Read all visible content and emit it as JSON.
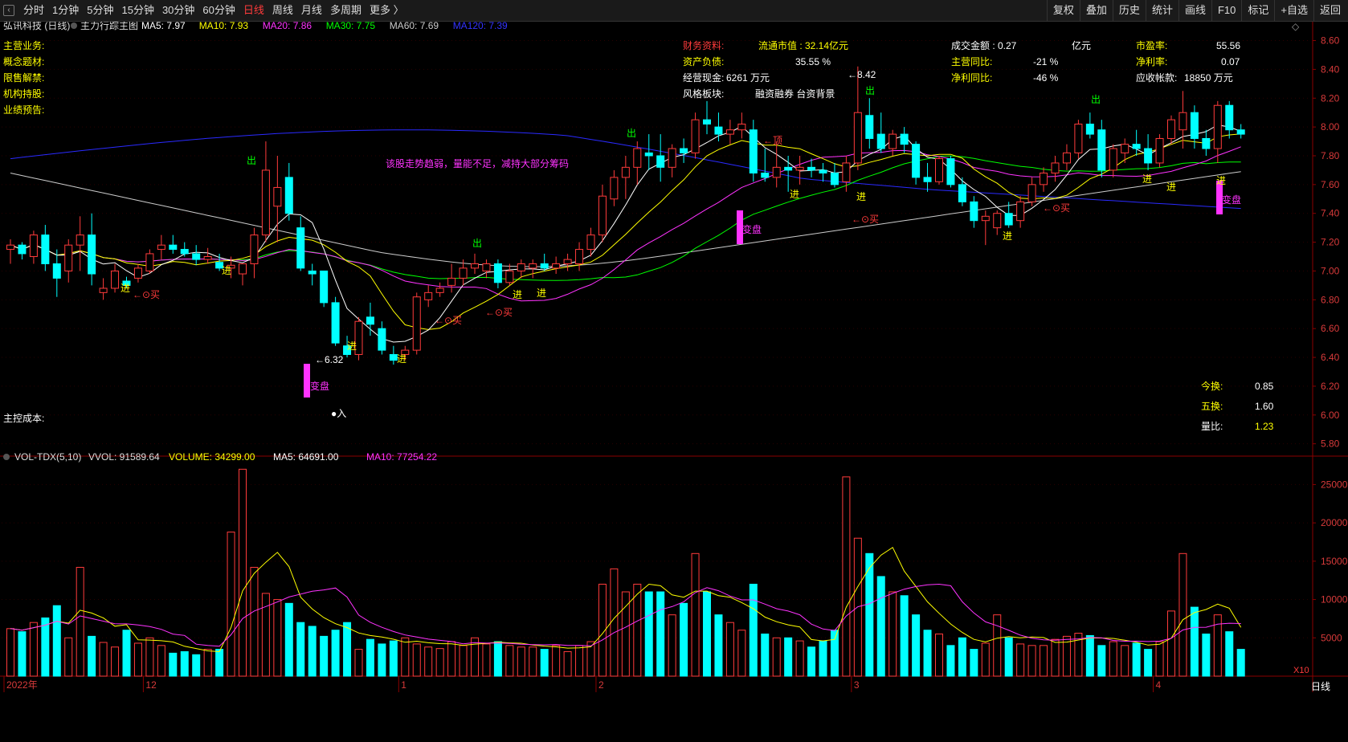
{
  "toolbar": {
    "left_items": [
      "分时",
      "1分钟",
      "5分钟",
      "15分钟",
      "30分钟",
      "60分钟",
      "日线",
      "周线",
      "月线",
      "多周期",
      "更多 〉"
    ],
    "active_index": 6,
    "right_items": [
      "复权",
      "叠加",
      "历史",
      "统计",
      "画线",
      "F10",
      "标记",
      "+自选",
      "返回"
    ]
  },
  "header": {
    "stock": "弘讯科技 (日线)",
    "indicator": "主力行踪主图",
    "mas": [
      {
        "label": "MA5: 7.97",
        "color": "#ffffff"
      },
      {
        "label": "MA10: 7.93",
        "color": "#ffff00"
      },
      {
        "label": "MA20: 7.86",
        "color": "#ff33ff"
      },
      {
        "label": "MA30: 7.75",
        "color": "#00ff00"
      },
      {
        "label": "MA60: 7.69",
        "color": "#cccccc"
      },
      {
        "label": "MA120: 7.39",
        "color": "#3333ff"
      }
    ]
  },
  "left_labels": [
    "主营业务:",
    "概念题材:",
    "限售解禁:",
    "机构持股:",
    "业绩预告:"
  ],
  "main_cost_label": "主控成本:",
  "finance": {
    "title": "财务资料:",
    "float_mv": "流通市值 : 32.14亿元",
    "debt_ratio_label": "资产负债:",
    "debt_ratio_value": "35.55 %",
    "cash_label": "经营现金:",
    "cash_value": "6261 万元",
    "style_label": "风格板块:",
    "style_value": "融资融券 台资背景",
    "turnover_amt_label": "成交金额 : 0.27",
    "turnover_amt_unit": "亿元",
    "rev_yoy_label": "主营同比:",
    "rev_yoy_value": "-21 %",
    "np_yoy_label": "净利同比:",
    "np_yoy_value": "-46 %",
    "pe_label": "市盈率:",
    "pe_value": "55.56",
    "npm_label": "净利率:",
    "npm_value": "0.07",
    "ar_label": "应收帐款:",
    "ar_value": "18850 万元"
  },
  "turnover_box": {
    "today_label": "今换:",
    "today_value": "0.85",
    "five_label": "五换:",
    "five_value": "1.60",
    "ratio_label": "量比:",
    "ratio_value": "1.23"
  },
  "annotations": {
    "trend_note": "该股走势趋弱，量能不足，减持大部分筹码",
    "low_label": "6.32",
    "high_label": "8.42",
    "in_label": "●入",
    "buy": "买",
    "enter": "进",
    "out": "出",
    "top": "←顶",
    "bianpan": "变盘"
  },
  "volume_header": {
    "name": "VOL-TDX(5,10)",
    "vvol": "VVOL: 91589.64",
    "volume": "VOLUME: 34299.00",
    "ma5": "MA5: 64691.00",
    "ma10": "MA10: 77254.22"
  },
  "x10_label": "X10",
  "period_label": "日线",
  "colors": {
    "up": "#ff3b3b",
    "down": "#00ffff",
    "ma5": "#ffffff",
    "ma10": "#ffff00",
    "ma20": "#ff33ff",
    "ma30": "#00ff00",
    "ma60": "#cccccc",
    "ma120": "#2a2aff",
    "grid": "#8b0000"
  },
  "chart_data": {
    "type": "candlestick",
    "price_axis_ticks": [
      8.6,
      8.4,
      8.2,
      8.0,
      7.8,
      7.6,
      7.4,
      7.2,
      7.0,
      6.8,
      6.6,
      6.4,
      6.2,
      6.0,
      5.8
    ],
    "price_range": [
      5.72,
      8.72
    ],
    "volume_axis_ticks": [
      25000,
      20000,
      15000,
      10000,
      5000
    ],
    "volume_range": [
      0,
      28500
    ],
    "x_labels": [
      {
        "i": 0,
        "text": "2022年"
      },
      {
        "i": 12,
        "text": "12"
      },
      {
        "i": 34,
        "text": "1"
      },
      {
        "i": 51,
        "text": "2"
      },
      {
        "i": 73,
        "text": "3"
      },
      {
        "i": 99,
        "text": "4"
      }
    ],
    "candles": [
      [
        7.15,
        7.22,
        7.05,
        7.18
      ],
      [
        7.18,
        7.2,
        7.08,
        7.12
      ],
      [
        7.1,
        7.28,
        7.05,
        7.25
      ],
      [
        7.25,
        7.32,
        7.0,
        7.05
      ],
      [
        7.05,
        7.15,
        6.82,
        6.95
      ],
      [
        7.0,
        7.22,
        6.92,
        7.18
      ],
      [
        7.18,
        7.38,
        7.0,
        7.25
      ],
      [
        7.25,
        7.4,
        6.9,
        6.98
      ],
      [
        6.85,
        6.95,
        6.8,
        6.88
      ],
      [
        6.88,
        7.05,
        6.85,
        7.0
      ],
      [
        6.93,
        6.96,
        6.88,
        6.9
      ],
      [
        6.95,
        7.05,
        6.92,
        7.02
      ],
      [
        7.0,
        7.15,
        6.98,
        7.12
      ],
      [
        7.15,
        7.25,
        7.08,
        7.18
      ],
      [
        7.18,
        7.25,
        7.12,
        7.15
      ],
      [
        7.15,
        7.2,
        7.1,
        7.12
      ],
      [
        7.12,
        7.18,
        7.04,
        7.08
      ],
      [
        7.08,
        7.16,
        7.05,
        7.1
      ],
      [
        7.06,
        7.12,
        7.0,
        7.02
      ],
      [
        7.02,
        7.1,
        6.95,
        7.04
      ],
      [
        6.98,
        7.05,
        6.9,
        7.05
      ],
      [
        7.05,
        7.3,
        6.95,
        7.25
      ],
      [
        7.25,
        7.9,
        7.2,
        7.7
      ],
      [
        7.45,
        7.8,
        7.2,
        7.58
      ],
      [
        7.65,
        7.75,
        7.35,
        7.4
      ],
      [
        7.3,
        7.38,
        7.0,
        7.02
      ],
      [
        7.0,
        7.05,
        6.9,
        6.98
      ],
      [
        7.0,
        7.0,
        6.75,
        6.78
      ],
      [
        6.78,
        6.82,
        6.48,
        6.5
      ],
      [
        6.48,
        6.55,
        6.4,
        6.42
      ],
      [
        6.42,
        6.68,
        6.38,
        6.65
      ],
      [
        6.68,
        6.78,
        6.55,
        6.63
      ],
      [
        6.6,
        6.65,
        6.42,
        6.45
      ],
      [
        6.42,
        6.48,
        6.35,
        6.38
      ],
      [
        6.42,
        6.48,
        6.38,
        6.45
      ],
      [
        6.45,
        6.85,
        6.42,
        6.82
      ],
      [
        6.8,
        6.9,
        6.75,
        6.85
      ],
      [
        6.85,
        6.92,
        6.82,
        6.88
      ],
      [
        6.9,
        7.05,
        6.85,
        6.95
      ],
      [
        6.95,
        7.08,
        6.9,
        7.02
      ],
      [
        7.02,
        7.12,
        6.98,
        7.05
      ],
      [
        7.0,
        7.08,
        6.95,
        7.05
      ],
      [
        7.05,
        7.08,
        6.88,
        6.92
      ],
      [
        6.92,
        7.05,
        6.9,
        7.0
      ],
      [
        7.0,
        7.08,
        6.95,
        7.05
      ],
      [
        7.02,
        7.08,
        6.95,
        7.05
      ],
      [
        7.05,
        7.12,
        7.0,
        7.02
      ],
      [
        7.02,
        7.1,
        6.98,
        7.05
      ],
      [
        7.05,
        7.12,
        7.0,
        7.08
      ],
      [
        7.05,
        7.2,
        7.0,
        7.15
      ],
      [
        7.15,
        7.3,
        7.1,
        7.25
      ],
      [
        7.25,
        7.6,
        7.2,
        7.52
      ],
      [
        7.5,
        7.7,
        7.45,
        7.65
      ],
      [
        7.65,
        7.8,
        7.5,
        7.72
      ],
      [
        7.72,
        7.9,
        7.6,
        7.85
      ],
      [
        7.82,
        7.95,
        7.7,
        7.8
      ],
      [
        7.8,
        7.95,
        7.62,
        7.72
      ],
      [
        7.72,
        7.88,
        7.65,
        7.85
      ],
      [
        7.85,
        7.92,
        7.75,
        7.82
      ],
      [
        7.82,
        8.1,
        7.78,
        8.05
      ],
      [
        8.05,
        8.18,
        7.95,
        8.02
      ],
      [
        8.0,
        8.1,
        7.9,
        7.95
      ],
      [
        7.95,
        8.05,
        7.88,
        7.98
      ],
      [
        7.98,
        8.1,
        7.92,
        8.02
      ],
      [
        7.98,
        8.05,
        7.62,
        7.68
      ],
      [
        7.68,
        7.85,
        7.62,
        7.65
      ],
      [
        7.65,
        7.9,
        7.58,
        7.72
      ],
      [
        7.72,
        7.8,
        7.55,
        7.7
      ],
      [
        7.7,
        7.8,
        7.6,
        7.72
      ],
      [
        7.72,
        7.78,
        7.65,
        7.7
      ],
      [
        7.7,
        7.75,
        7.62,
        7.68
      ],
      [
        7.68,
        7.75,
        7.58,
        7.6
      ],
      [
        7.62,
        7.8,
        7.55,
        7.75
      ],
      [
        7.75,
        8.42,
        7.7,
        8.1
      ],
      [
        8.08,
        8.2,
        7.85,
        7.92
      ],
      [
        7.95,
        8.1,
        7.82,
        7.85
      ],
      [
        7.85,
        7.98,
        7.8,
        7.95
      ],
      [
        7.95,
        8.0,
        7.82,
        7.88
      ],
      [
        7.88,
        7.9,
        7.6,
        7.65
      ],
      [
        7.65,
        7.75,
        7.55,
        7.62
      ],
      [
        7.62,
        7.8,
        7.6,
        7.78
      ],
      [
        7.78,
        7.8,
        7.58,
        7.6
      ],
      [
        7.6,
        7.65,
        7.45,
        7.48
      ],
      [
        7.48,
        7.52,
        7.3,
        7.35
      ],
      [
        7.35,
        7.42,
        7.18,
        7.38
      ],
      [
        7.3,
        7.42,
        7.25,
        7.4
      ],
      [
        7.4,
        7.48,
        7.3,
        7.32
      ],
      [
        7.35,
        7.52,
        7.3,
        7.48
      ],
      [
        7.48,
        7.65,
        7.45,
        7.6
      ],
      [
        7.6,
        7.72,
        7.55,
        7.68
      ],
      [
        7.68,
        7.8,
        7.62,
        7.75
      ],
      [
        7.75,
        7.88,
        7.7,
        7.82
      ],
      [
        7.82,
        8.05,
        7.78,
        8.02
      ],
      [
        8.02,
        8.1,
        7.92,
        7.95
      ],
      [
        7.98,
        8.05,
        7.65,
        7.7
      ],
      [
        7.7,
        7.88,
        7.65,
        7.85
      ],
      [
        7.82,
        7.92,
        7.75,
        7.88
      ],
      [
        7.88,
        7.98,
        7.8,
        7.85
      ],
      [
        7.85,
        7.95,
        7.7,
        7.75
      ],
      [
        7.75,
        7.95,
        7.72,
        7.92
      ],
      [
        7.92,
        8.08,
        7.88,
        8.05
      ],
      [
        7.98,
        8.25,
        7.85,
        8.1
      ],
      [
        8.1,
        8.15,
        7.85,
        7.92
      ],
      [
        7.92,
        7.98,
        7.8,
        7.85
      ],
      [
        7.85,
        8.18,
        7.75,
        8.15
      ],
      [
        8.15,
        8.18,
        7.92,
        7.98
      ],
      [
        7.98,
        8.02,
        7.92,
        7.95
      ]
    ],
    "volume": [
      6200,
      5800,
      7000,
      7600,
      9200,
      5000,
      14200,
      5200,
      4400,
      3800,
      6000,
      4300,
      5000,
      4000,
      3000,
      3200,
      2800,
      3500,
      3500,
      18800,
      27000,
      14200,
      10800,
      10000,
      9500,
      7000,
      6500,
      5200,
      6000,
      7000,
      3500,
      4800,
      4200,
      4600,
      5000,
      4200,
      3800,
      3600,
      4500,
      4000,
      5000,
      4200,
      4500,
      4000,
      3800,
      3800,
      3500,
      4000,
      3200,
      4000,
      4500,
      12000,
      14000,
      11000,
      12000,
      11000,
      11000,
      8000,
      9500,
      16000,
      11000,
      8000,
      7000,
      6000,
      12000,
      5500,
      5000,
      5000,
      4600,
      3800,
      4600,
      6000,
      26000,
      18000,
      16000,
      13000,
      11000,
      10500,
      8000,
      6000,
      5500,
      4000,
      5000,
      3500,
      4300,
      8000,
      5000,
      4200,
      4000,
      4000,
      4800,
      5200,
      5600,
      5300,
      4000,
      4500,
      4000,
      4300,
      3500,
      4500,
      8500,
      16000,
      9000,
      5500,
      8000,
      5800,
      3500
    ],
    "ma_series_note": "MA5 white, MA10 yellow, MA20 magenta, MA30 green, MA60 gray, MA120 blue"
  }
}
